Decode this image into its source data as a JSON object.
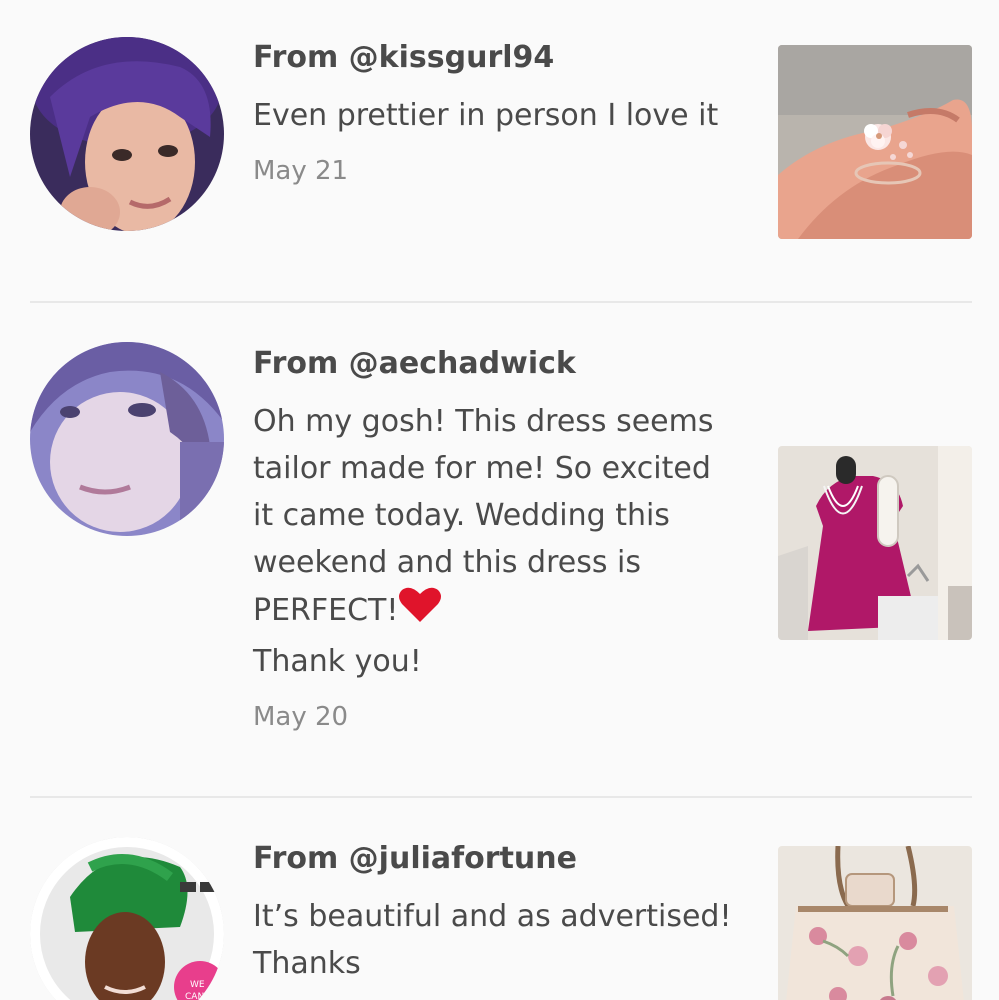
{
  "reviews": [
    {
      "from": "From @kissgurl94",
      "text": "Even prettier in person I love it",
      "date": "May 21",
      "photo": "ring-on-hand"
    },
    {
      "from": "From @aechadwick",
      "text": "Oh my gosh! This dress seems tailor made for me! So excited it came today. Wedding this weekend and this dress is PERFECT!",
      "text_end": "Thank you!",
      "emoji": "red-heart",
      "date": "May 20",
      "photo": "magenta-dress-on-mannequin"
    },
    {
      "from": "From @juliafortune",
      "text": "It’s beautiful and as advertised! Thanks",
      "photo": "floral-tote-bag"
    }
  ],
  "colors": {
    "background": "#fafafa",
    "text": "#4a4a4a",
    "date": "#8a8a8a",
    "divider": "#e8e8e8",
    "heart": "#e0142b"
  }
}
